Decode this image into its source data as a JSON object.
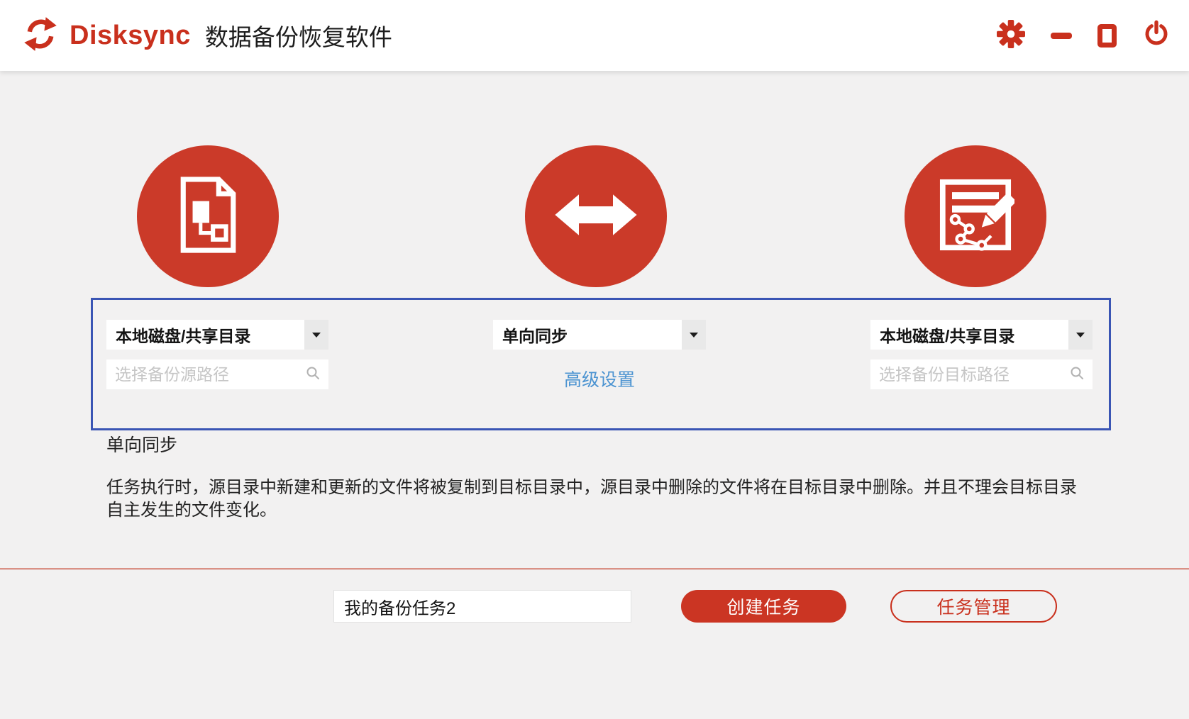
{
  "header": {
    "brand": "Disksync",
    "title": "数据备份恢复软件",
    "window_controls": {
      "settings": "设置",
      "minimize": "最小化",
      "maximize": "最大化",
      "power": "退出"
    }
  },
  "panel": {
    "source_type": "本地磁盘/共享目录",
    "source_placeholder": "选择备份源路径",
    "sync_mode": "单向同步",
    "advanced_link": "高级设置",
    "target_type": "本地磁盘/共享目录",
    "target_placeholder": "选择备份目标路径"
  },
  "description": {
    "title": "单向同步",
    "lines": [
      "任务执行时，源目录中新建和更新的文件将被复制到目标目录中，源目录中删除的文件将在目标目录中删除。并且不理会目标目录",
      "自主发生的文件变化。"
    ]
  },
  "footer": {
    "task_name": "我的备份任务2",
    "create_label": "创建任务",
    "manage_label": "任务管理"
  },
  "icons": {
    "logo": "sync-arrows",
    "circle_left": "source-document-structure",
    "circle_middle": "two-way-arrow",
    "circle_right": "task-edit-document"
  },
  "colors": {
    "accent_red": "#c9301d",
    "circle_red": "#cb3a29",
    "panel_border_blue": "#3a55b4",
    "link_blue": "#4b93d1",
    "background": "#f2f1f1",
    "header_background": "#ffffff",
    "placeholder_gray": "#c6c6c6"
  }
}
